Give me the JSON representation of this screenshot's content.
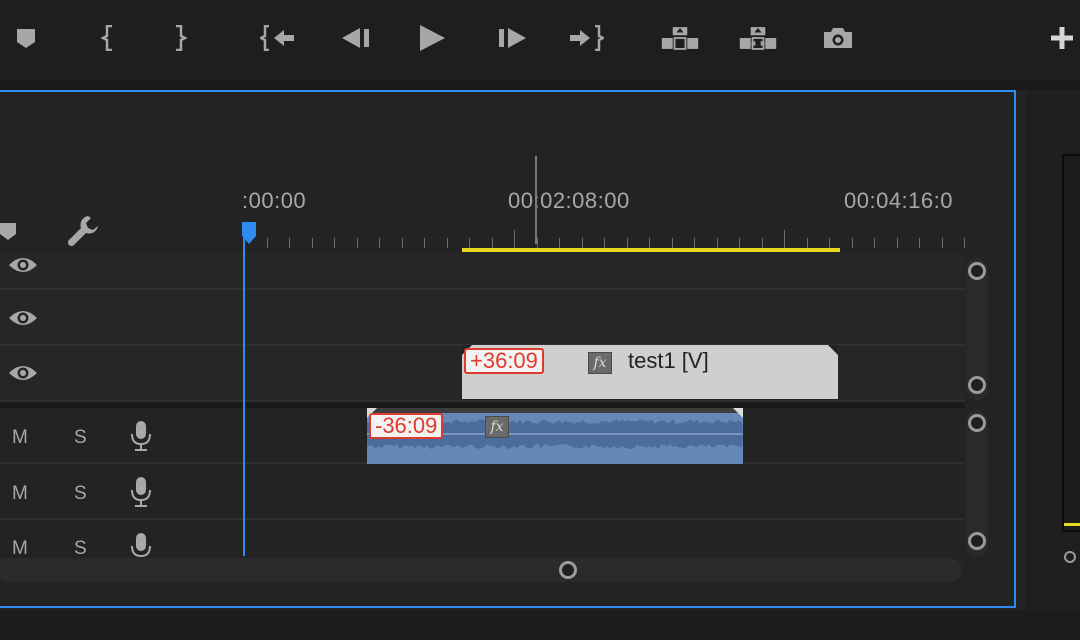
{
  "toolbar": {
    "buttons": [
      {
        "name": "add-marker-button",
        "icon": "marker-icon"
      },
      {
        "name": "mark-in-button",
        "icon": "mark-in-icon"
      },
      {
        "name": "mark-out-button",
        "icon": "mark-out-icon"
      },
      {
        "name": "go-to-in-button",
        "icon": "go-to-in-icon"
      },
      {
        "name": "step-back-button",
        "icon": "step-back-icon"
      },
      {
        "name": "play-button",
        "icon": "play-icon"
      },
      {
        "name": "step-forward-button",
        "icon": "step-forward-icon"
      },
      {
        "name": "go-to-out-button",
        "icon": "go-to-out-icon"
      },
      {
        "name": "lift-button",
        "icon": "lift-icon"
      },
      {
        "name": "extract-button",
        "icon": "extract-icon"
      },
      {
        "name": "export-frame-button",
        "icon": "camera-icon"
      },
      {
        "name": "add-button",
        "icon": "plus-icon"
      }
    ]
  },
  "ruler": {
    "labels": [
      ":00:00",
      "00:02:08:00",
      "00:04:16:0"
    ]
  },
  "tracks": {
    "video": [
      {
        "eye_icon": "eye-icon"
      },
      {
        "eye_icon": "eye-icon"
      },
      {
        "eye_icon": "eye-icon"
      }
    ],
    "audio": [
      {
        "mute": "M",
        "solo": "S",
        "icon": "microphone-icon"
      },
      {
        "mute": "M",
        "solo": "S",
        "icon": "microphone-icon"
      },
      {
        "mute": "M",
        "solo": "S",
        "icon": "microphone-icon"
      }
    ]
  },
  "clips": {
    "video": {
      "offset": "+36:09",
      "fx": "fx",
      "name": "test1 [V]"
    },
    "audio": {
      "offset": "-36:09",
      "fx": "fx"
    }
  },
  "colors": {
    "accent": "#2e8cf0",
    "offset_red": "#e03a2c",
    "work_area_yellow": "#e6d61c",
    "audio_clip": "#6488b8",
    "video_clip": "#cfcfcf"
  }
}
